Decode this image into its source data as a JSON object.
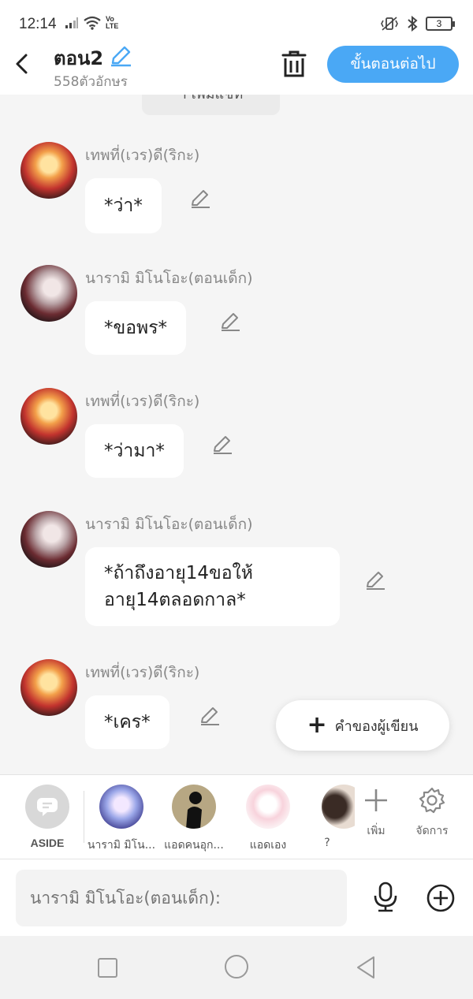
{
  "status": {
    "time": "12:14",
    "volte": "Vo\nLTE",
    "battery": "3"
  },
  "header": {
    "title": "ตอน2",
    "char_count": "558ตัวอักษร",
    "next_label": "ขั้นตอนต่อไป"
  },
  "chat": {
    "top_chip": "ำ เพิ่มแชท",
    "messages": [
      {
        "name": "เทพที่(เวร)ดี(ริกะ)",
        "text": "*ว่า*"
      },
      {
        "name": "นารามิ มิโนโอะ(ตอนเด็ก)",
        "text": "*ขอพร*"
      },
      {
        "name": "เทพที่(เวร)ดี(ริกะ)",
        "text": "*ว่ามา*"
      },
      {
        "name": "นารามิ มิโนโอะ(ตอนเด็ก)",
        "text_line1": "*ถ้าถึงอายุ14ขอให้",
        "text_line2": "อายุ14ตลอดกาล*"
      },
      {
        "name": "เทพที่(เวร)ดี(ริกะ)",
        "text": "*เคร*"
      }
    ]
  },
  "fab": {
    "label": "คำของผู้เขียน"
  },
  "characters": [
    {
      "label": "ASIDE"
    },
    {
      "label": "นารามิ มิโน..."
    },
    {
      "label": "แอดคนอุก..."
    },
    {
      "label": "แอดเอง"
    },
    {
      "label": "?"
    }
  ],
  "tools": {
    "add_label": "เพิ่ม",
    "manage_label": "จัดการ"
  },
  "input": {
    "placeholder": "นารามิ มิโนโอะ(ตอนเด็ก):"
  },
  "colors": {
    "accent": "#4aa8f5",
    "background": "#f5f5f5"
  }
}
